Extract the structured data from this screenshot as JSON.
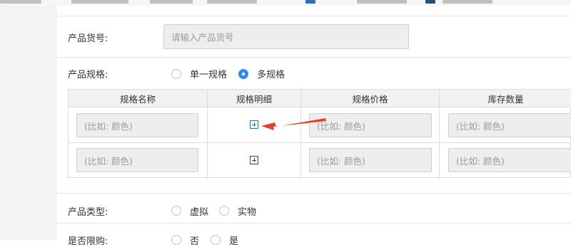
{
  "product_code": {
    "label": "产品货号:",
    "placeholder": "请输入产品货号",
    "value": ""
  },
  "product_spec": {
    "label": "产品规格:",
    "options": [
      {
        "label": "单一规格",
        "checked": false
      },
      {
        "label": "多规格",
        "checked": true
      }
    ]
  },
  "spec_table": {
    "headers": [
      "规格名称",
      "规格明细",
      "规格价格",
      "库存数量"
    ],
    "rows": [
      {
        "name_placeholder": "(比如: 颜色)",
        "price_placeholder": "(比如: 颜色)",
        "stock_placeholder": "(比如: 颜色)"
      },
      {
        "name_placeholder": "(比如: 颜色)",
        "price_placeholder": "(比如: 颜色)",
        "stock_placeholder": "(比如: 颜色)"
      }
    ]
  },
  "product_type": {
    "label": "产品类型:",
    "options": [
      {
        "label": "虚拟",
        "checked": false
      },
      {
        "label": "实物",
        "checked": false
      }
    ]
  },
  "purchase_limit": {
    "label": "是否限购:",
    "options": [
      {
        "label": "否",
        "checked": false
      },
      {
        "label": "是",
        "checked": false
      }
    ]
  },
  "colors": {
    "accent": "#2f8de4",
    "arrow": "#e83c2c"
  },
  "icons": {
    "add_spec_detail": "plus-square-icon"
  }
}
